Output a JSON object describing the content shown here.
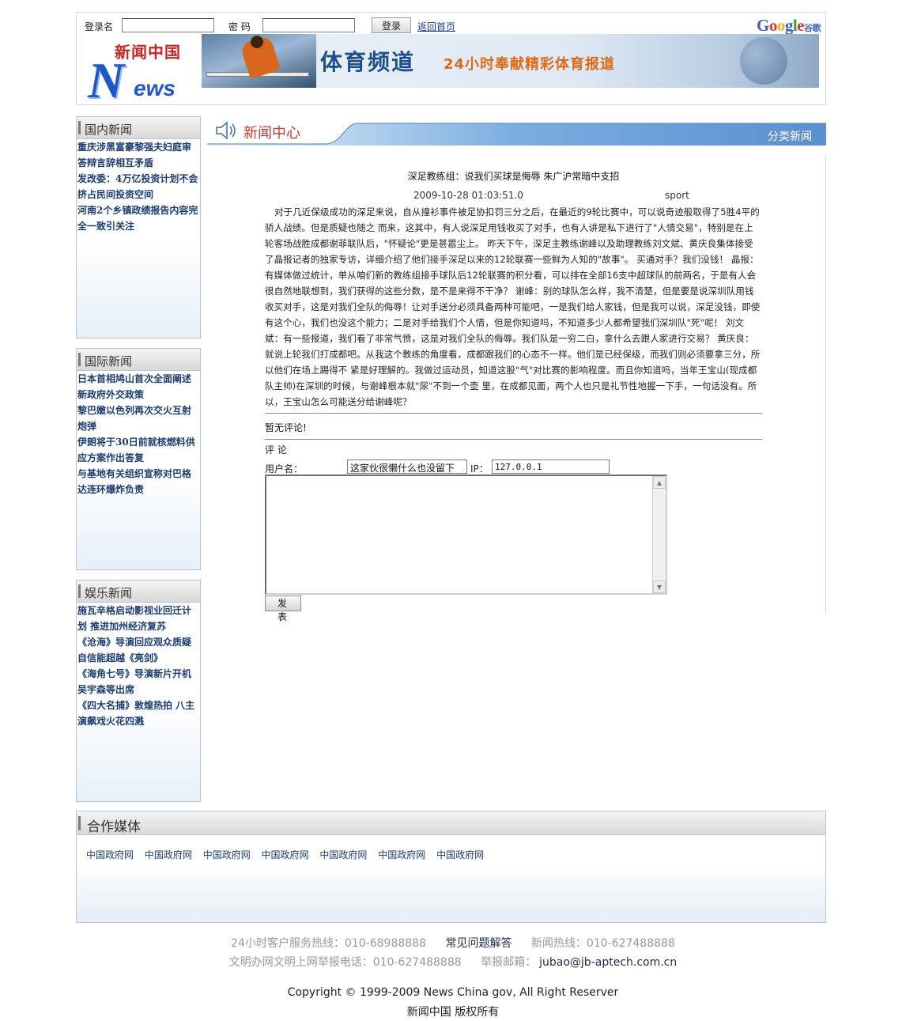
{
  "header": {
    "username_label": "登录名",
    "password_label": "密 码",
    "login_button": "登录",
    "home_link": "返回首页",
    "google_logo": "Google",
    "google_cn": "谷歌",
    "logo_cn": "新闻中国",
    "logo_n": "N",
    "logo_ews": "ews",
    "banner_title": "体育频道",
    "banner_subtitle": "24小时奉献精彩体育报道"
  },
  "sidebar": {
    "domestic": {
      "title": "国内新闻",
      "items": [
        "重庆涉黑富豪黎强夫妇庭审答辩言辞相互矛盾",
        "发改委：4万亿投资计划不会挤占民间投资空间",
        "河南2个乡镇政绩报告内容完全一致引关注"
      ]
    },
    "international": {
      "title": "国际新闻",
      "items": [
        "日本首相鸠山首次全面阐述新政府外交政策",
        "黎巴嫩以色列再次交火互射炮弹",
        "伊朗将于30日前就核燃料供应方案作出答复",
        "与基地有关组织宣称对巴格达连环爆炸负责"
      ]
    },
    "entertainment": {
      "title": "娱乐新闻",
      "items": [
        "施瓦辛格启动影视业回迁计划 推进加州经济复苏",
        "《沧海》导演回应观众质疑自信能超越《亮剑》",
        "《海角七号》导演新片开机吴宇森等出席",
        "《四大名捕》敦煌热拍 八主演飙戏火花四溅"
      ]
    }
  },
  "news_center": {
    "title": "新闻中心",
    "category_link": "分类新闻"
  },
  "article": {
    "title": "深足教练组：说我们买球是侮辱 朱广沪常暗中支招",
    "date": "2009-10-28 01:03:51.0",
    "category": "sport",
    "body": "对于几近保级成功的深足来说，自从撞衫事件被足协扣罚三分之后，在最近的9轮比赛中，可以说奇迹般取得了5胜4平的骄人战绩。但是质疑也随之 而来，这其中，有人说深足用钱收买了对手，也有人讲是私下进行了\"人情交易\"，特别是在上轮客场战胜成都谢菲联队后，\"怀疑论\"更是甚嚣尘上。 昨天下午，深足主教练谢峰以及助理教练刘文斌、黄庆良集体接受了晶报记者的独家专访，详细介绍了他们接手深足以来的12轮联赛一些鲜为人知的\"故事\"。 买通对手？我们没钱！ 晶报：有媒体做过统计，单从咱们新的教练组接手球队后12轮联赛的积分看，可以排在全部16支中超球队的前两名，于是有人会很自然地联想到，我们获得的这些分数，是不是来得不干净？ 谢峰：别的球队怎么样，我不清楚，但是要是说深圳队用钱收买对手，这是对我们全队的侮辱！让对手送分必须具备两种可能吧，一是我们给人家钱，但是我可以说，深足没钱，即使有这个心，我们也没这个能力；二是对手给我们个人情，但是你知道吗，不知道多少人都希望我们深圳队\"死\"呢！ 刘文斌：有一些报道，我们看了非常气愤，这是对我们全队的侮辱。我们队是一穷二白，拿什么去跟人家进行交易？ 黄庆良：就说上轮我们打成都吧。从我这个教练的角度看，成都跟我们的心态不一样。他们是已经保级，而我们则必须要拿三分，所以他们在场上踢得不 紧是好理解的。我做过运动员，知道这股\"气\"对比赛的影响程度。而且你知道吗，当年王宝山(现成都队主帅)在深圳的时候，与谢峰根本就\"尿\"不到一个壶 里，在成都见面，两个人也只是礼节性地握一下手，一句话没有。所以，王宝山怎么可能送分给谢峰呢？",
    "no_comment": "暂无评论!"
  },
  "comment_form": {
    "label": "评 论",
    "user_label": "用户名：",
    "user_value": "这家伙很懒什么也没留下",
    "ip_label": "IP：",
    "ip_value": "127.0.0.1",
    "submit": "发 表"
  },
  "partners": {
    "title": "合作媒体",
    "links": [
      "中国政府网",
      "中国政府网",
      "中国政府网",
      "中国政府网",
      "中国政府网",
      "中国政府网",
      "中国政府网"
    ]
  },
  "footer": {
    "service_hotline": "24小时客户服务热线：010-68988888",
    "faq": "常见问题解答",
    "news_hotline": "新闻热线：010-627488888",
    "civilized": "文明办网文明上网举报电话：010-627488888",
    "report_email_label": "举报邮箱：",
    "report_email": "jubao@jb-aptech.com.cn",
    "copyright": "Copyright © 1999-2009 News China gov, All Right Reserver",
    "rights": "新闻中国 版权所有"
  },
  "colors": {
    "link_blue": "#1b3d73",
    "title_red": "#c8372d",
    "bar_blue": "#5a8fd0"
  }
}
